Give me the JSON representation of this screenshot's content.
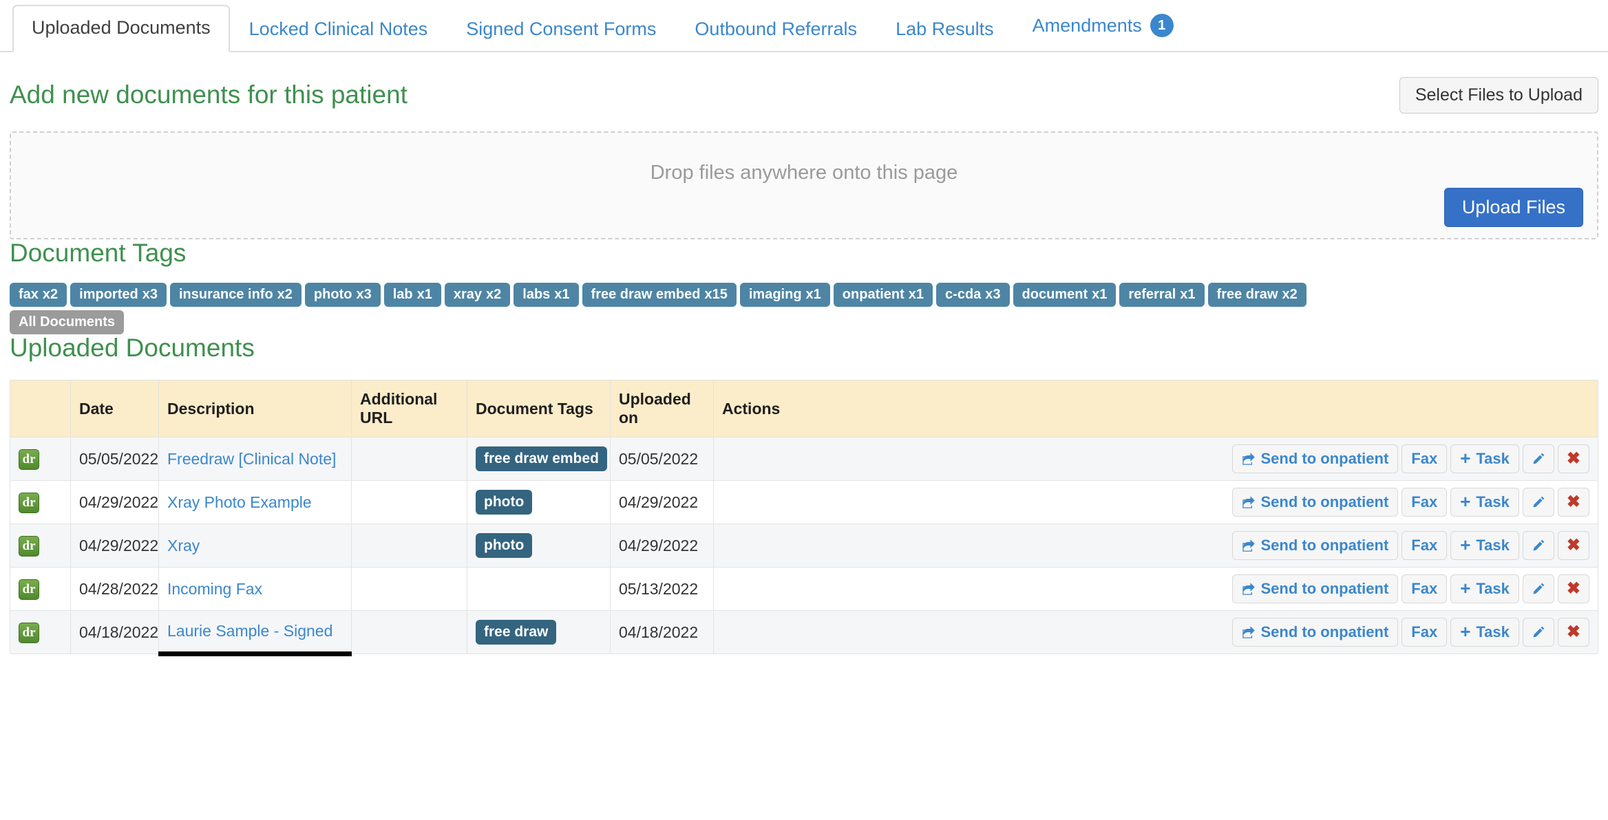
{
  "tabs": [
    {
      "label": "Uploaded Documents",
      "active": true,
      "badge": null
    },
    {
      "label": "Locked Clinical Notes",
      "active": false,
      "badge": null
    },
    {
      "label": "Signed Consent Forms",
      "active": false,
      "badge": null
    },
    {
      "label": "Outbound Referrals",
      "active": false,
      "badge": null
    },
    {
      "label": "Lab Results",
      "active": false,
      "badge": null
    },
    {
      "label": "Amendments",
      "active": false,
      "badge": "1"
    }
  ],
  "upload": {
    "heading": "Add new documents for this patient",
    "select_files_label": "Select Files to Upload",
    "dropzone_text": "Drop files anywhere onto this page",
    "upload_button_label": "Upload Files"
  },
  "document_tags": {
    "heading": "Document Tags",
    "filters": [
      {
        "name": "fax",
        "count": "x2"
      },
      {
        "name": "imported",
        "count": "x3"
      },
      {
        "name": "insurance info",
        "count": "x2"
      },
      {
        "name": "photo",
        "count": "x3"
      },
      {
        "name": "lab",
        "count": "x1"
      },
      {
        "name": "xray",
        "count": "x2"
      },
      {
        "name": "labs",
        "count": "x1"
      },
      {
        "name": "free draw embed",
        "count": "x15"
      },
      {
        "name": "imaging",
        "count": "x1"
      },
      {
        "name": "onpatient",
        "count": "x1"
      },
      {
        "name": "c-cda",
        "count": "x3"
      },
      {
        "name": "document",
        "count": "x1"
      },
      {
        "name": "referral",
        "count": "x1"
      },
      {
        "name": "free draw",
        "count": "x2"
      }
    ],
    "all_documents_label": "All Documents"
  },
  "table": {
    "heading": "Uploaded Documents",
    "columns": [
      "",
      "Date",
      "Description",
      "Additional URL",
      "Document Tags",
      "Uploaded on",
      "Actions"
    ],
    "rows": [
      {
        "icon": "dr",
        "date": "05/05/2022",
        "description": "Freedraw [Clinical Note]",
        "additional_url": "",
        "tag": "free draw embed",
        "uploaded_on": "05/05/2022"
      },
      {
        "icon": "dr",
        "date": "04/29/2022",
        "description": "Xray Photo Example",
        "additional_url": "",
        "tag": "photo",
        "uploaded_on": "04/29/2022"
      },
      {
        "icon": "dr",
        "date": "04/29/2022",
        "description": "Xray",
        "additional_url": "",
        "tag": "photo",
        "uploaded_on": "04/29/2022"
      },
      {
        "icon": "dr",
        "date": "04/28/2022",
        "description": "Incoming Fax",
        "additional_url": "",
        "tag": "",
        "uploaded_on": "05/13/2022"
      },
      {
        "icon": "dr",
        "date": "04/18/2022",
        "description": "Laurie Sample - Signed",
        "additional_url": "",
        "tag": "free draw",
        "uploaded_on": "04/18/2022"
      }
    ],
    "actions": {
      "send_to_onpatient": "Send to onpatient",
      "fax": "Fax",
      "task": "Task",
      "edit_icon": "pencil-icon",
      "delete_icon": "close-icon"
    }
  },
  "colors": {
    "link_blue": "#3b87cd",
    "heading_green": "#3f904f",
    "primary_button": "#3671c8",
    "filter_tag": "#4e85a4",
    "row_tag": "#34647f",
    "table_header": "#fbecca",
    "delete_red": "#c0392b",
    "all_documents_gray": "#9b9b9b"
  }
}
